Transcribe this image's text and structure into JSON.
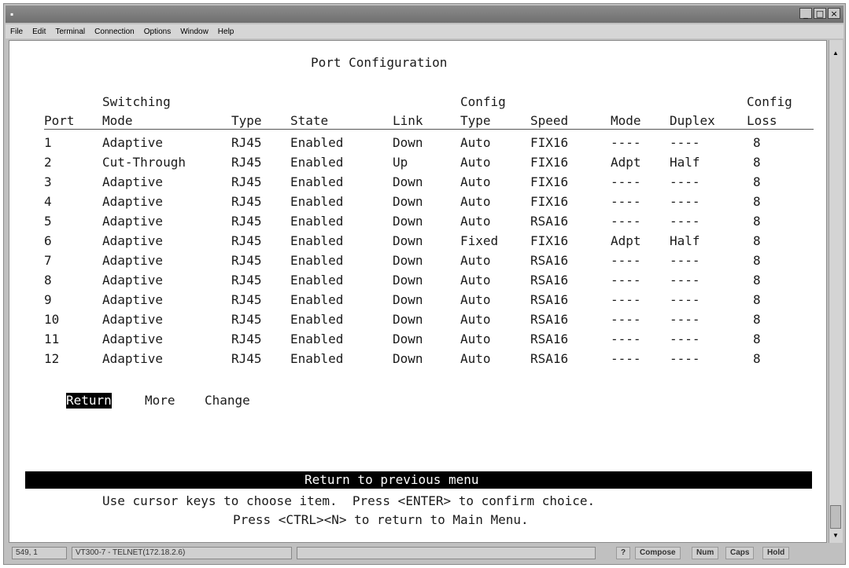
{
  "window": {
    "menu": [
      "File",
      "Edit",
      "Terminal",
      "Connection",
      "Options",
      "Window",
      "Help"
    ]
  },
  "screen": {
    "title": "Port Configuration",
    "headers": {
      "port": "Port",
      "switching_top": "Switching",
      "switching_bottom": "Mode",
      "type": "Type",
      "state": "State",
      "link": "Link",
      "config_type_top": "Config",
      "config_type_bottom": "Type",
      "speed": "Speed",
      "mode": "Mode",
      "duplex": "Duplex",
      "config_loss_top": "Config",
      "config_loss_bottom": "Loss"
    },
    "rows": [
      {
        "port": "1",
        "mode": "Adaptive",
        "type": "RJ45",
        "state": "Enabled",
        "link": "Down",
        "ctype": "Auto",
        "speed": "FIX16",
        "smode": "----",
        "duplex": "----",
        "loss": "8"
      },
      {
        "port": "2",
        "mode": "Cut-Through",
        "type": "RJ45",
        "state": "Enabled",
        "link": "Up",
        "ctype": "Auto",
        "speed": "FIX16",
        "smode": "Adpt",
        "duplex": "Half",
        "loss": "8"
      },
      {
        "port": "3",
        "mode": "Adaptive",
        "type": "RJ45",
        "state": "Enabled",
        "link": "Down",
        "ctype": "Auto",
        "speed": "FIX16",
        "smode": "----",
        "duplex": "----",
        "loss": "8"
      },
      {
        "port": "4",
        "mode": "Adaptive",
        "type": "RJ45",
        "state": "Enabled",
        "link": "Down",
        "ctype": "Auto",
        "speed": "FIX16",
        "smode": "----",
        "duplex": "----",
        "loss": "8"
      },
      {
        "port": "5",
        "mode": "Adaptive",
        "type": "RJ45",
        "state": "Enabled",
        "link": "Down",
        "ctype": "Auto",
        "speed": "RSA16",
        "smode": "----",
        "duplex": "----",
        "loss": "8"
      },
      {
        "port": "6",
        "mode": "Adaptive",
        "type": "RJ45",
        "state": "Enabled",
        "link": "Down",
        "ctype": "Fixed",
        "speed": "FIX16",
        "smode": "Adpt",
        "duplex": "Half",
        "loss": "8"
      },
      {
        "port": "7",
        "mode": "Adaptive",
        "type": "RJ45",
        "state": "Enabled",
        "link": "Down",
        "ctype": "Auto",
        "speed": "RSA16",
        "smode": "----",
        "duplex": "----",
        "loss": "8"
      },
      {
        "port": "8",
        "mode": "Adaptive",
        "type": "RJ45",
        "state": "Enabled",
        "link": "Down",
        "ctype": "Auto",
        "speed": "RSA16",
        "smode": "----",
        "duplex": "----",
        "loss": "8"
      },
      {
        "port": "9",
        "mode": "Adaptive",
        "type": "RJ45",
        "state": "Enabled",
        "link": "Down",
        "ctype": "Auto",
        "speed": "RSA16",
        "smode": "----",
        "duplex": "----",
        "loss": "8"
      },
      {
        "port": "10",
        "mode": "Adaptive",
        "type": "RJ45",
        "state": "Enabled",
        "link": "Down",
        "ctype": "Auto",
        "speed": "RSA16",
        "smode": "----",
        "duplex": "----",
        "loss": "8"
      },
      {
        "port": "11",
        "mode": "Adaptive",
        "type": "RJ45",
        "state": "Enabled",
        "link": "Down",
        "ctype": "Auto",
        "speed": "RSA16",
        "smode": "----",
        "duplex": "----",
        "loss": "8"
      },
      {
        "port": "12",
        "mode": "Adaptive",
        "type": "RJ45",
        "state": "Enabled",
        "link": "Down",
        "ctype": "Auto",
        "speed": "RSA16",
        "smode": "----",
        "duplex": "----",
        "loss": "8"
      }
    ],
    "actions": {
      "return": "Return",
      "more": "More",
      "change": "Change"
    },
    "status_message": "Return to previous menu",
    "help_line1": "Use cursor keys to choose item.  Press <ENTER> to confirm choice.",
    "help_line2": "Press <CTRL><N> to return to Main Menu."
  },
  "footer": {
    "position": "549, 1",
    "session": "VT300-7 - TELNET(172.18.2.6)",
    "help": "?",
    "compose": "Compose",
    "num": "Num",
    "caps": "Caps",
    "hold": "Hold"
  }
}
